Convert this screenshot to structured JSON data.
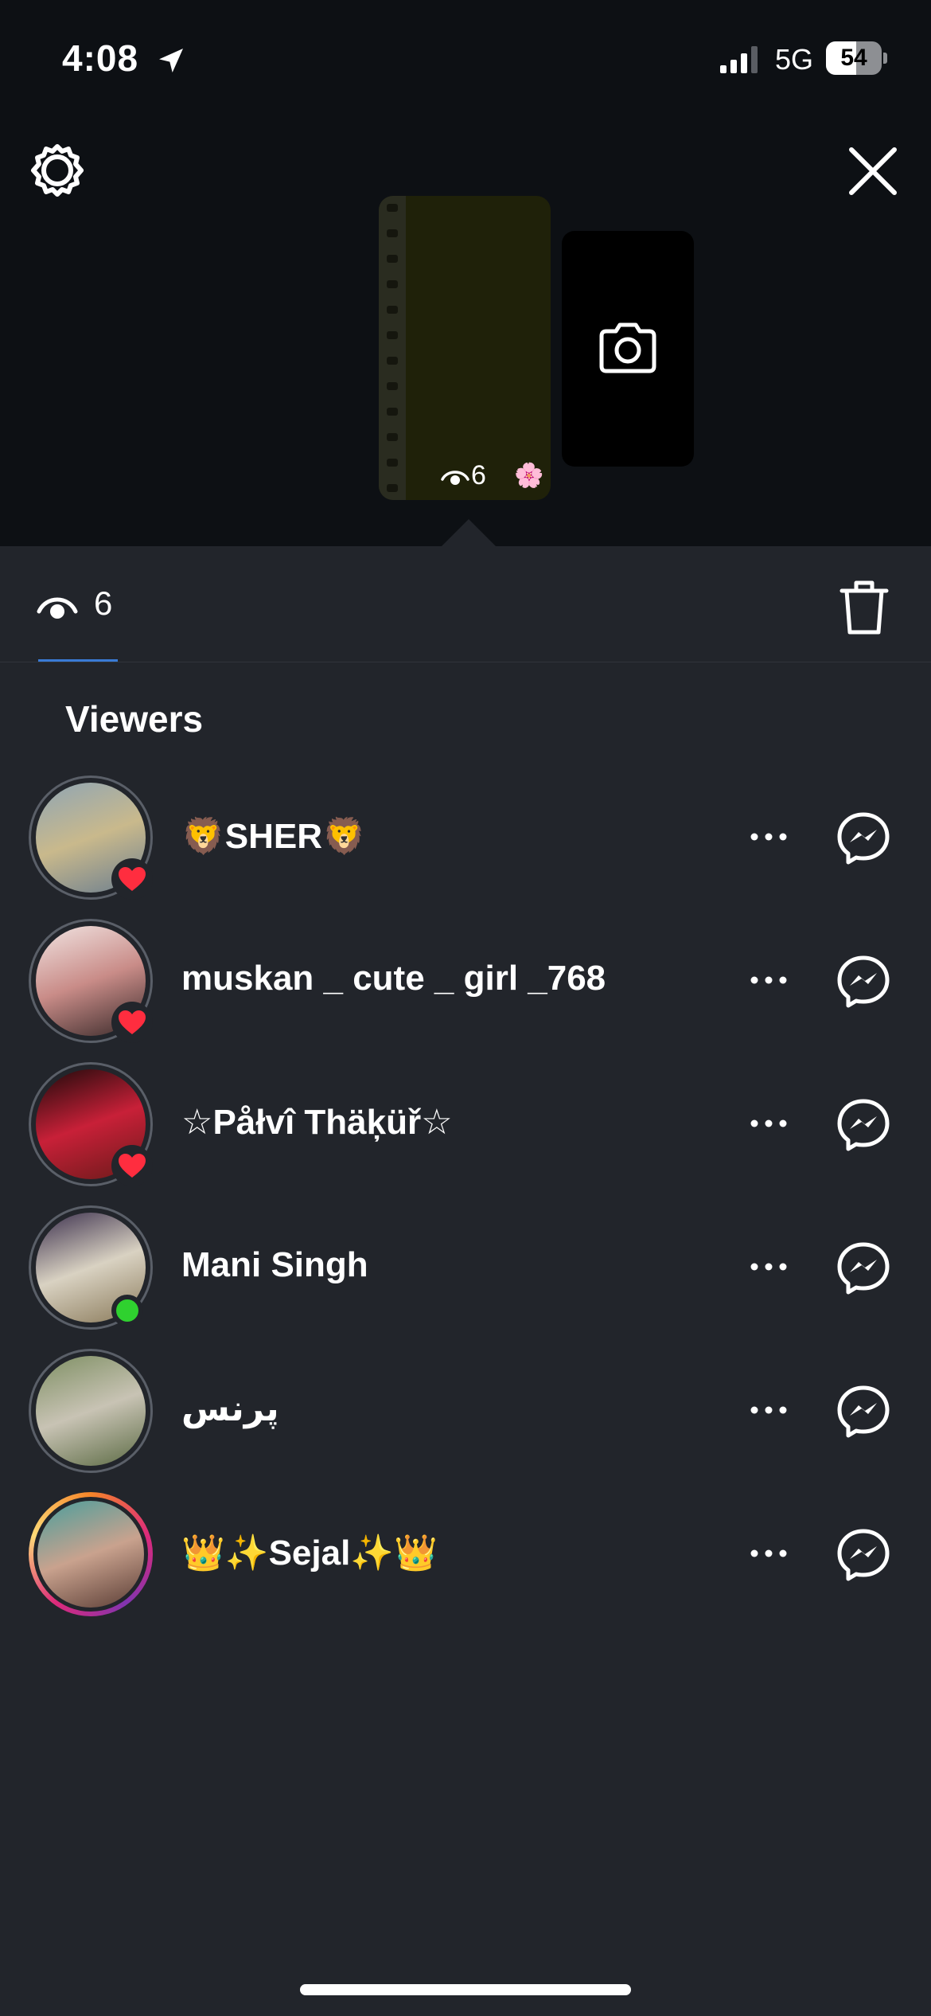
{
  "status_bar": {
    "time": "4:08",
    "network": "5G",
    "battery": "54"
  },
  "story_preview": {
    "view_count": "6",
    "sticker_emoji": "🌸"
  },
  "metrics": {
    "view_count": "6"
  },
  "viewers": {
    "heading": "Viewers",
    "items": [
      {
        "name": "🦁SHER🦁",
        "badge": "heart",
        "avatar_colors": [
          "#8fa5b4",
          "#c9b98c",
          "#6d7f8f"
        ]
      },
      {
        "name": "muskan _ cute _ girl _768",
        "badge": "heart",
        "avatar_colors": [
          "#f1e4e2",
          "#c98c88",
          "#3a2a2a"
        ]
      },
      {
        "name": "☆Påłvî Thäķüř☆",
        "badge": "heart",
        "avatar_colors": [
          "#1c0a0a",
          "#c82038",
          "#6b1a1a"
        ]
      },
      {
        "name": "Mani Singh",
        "badge": "online",
        "avatar_colors": [
          "#3b2f4d",
          "#d9d2c2",
          "#8a7a5a"
        ]
      },
      {
        "name": "پرنس",
        "badge": "none",
        "avatar_colors": [
          "#7e8f63",
          "#c8c3b4",
          "#5c6b44"
        ]
      },
      {
        "name": "👑✨Sejal✨👑",
        "badge": "story-ring",
        "avatar_colors": [
          "#4a9e9c",
          "#c9a28e",
          "#5a3d35"
        ]
      }
    ]
  },
  "colors": {
    "background": "#22252b",
    "top_background": "#0d1014",
    "heart": "#ff2d3f",
    "online": "#2fd12f",
    "tab_underline": "#3a7bd5"
  }
}
